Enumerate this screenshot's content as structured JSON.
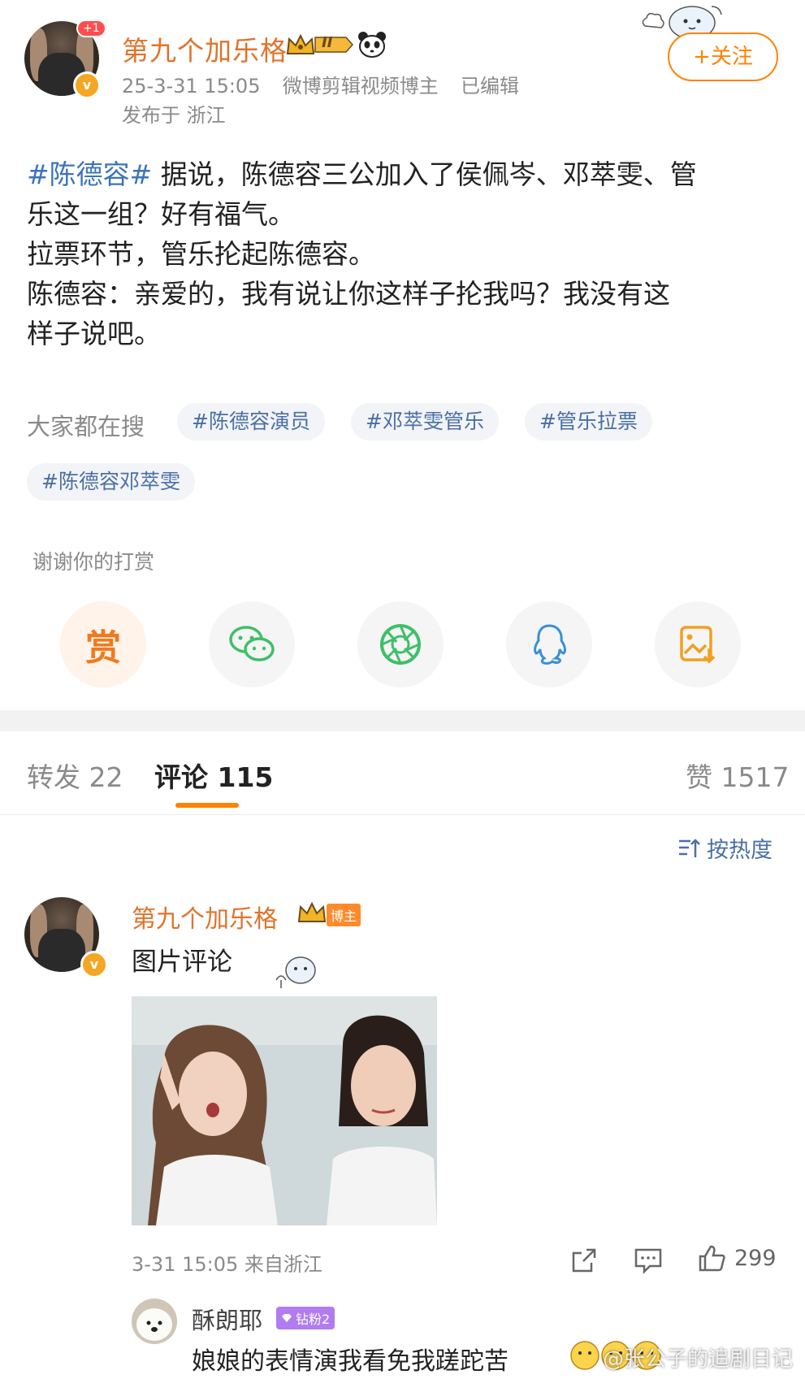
{
  "post": {
    "author": "第九个加乐格",
    "notification_count": "+1",
    "level_badge": "II",
    "date": "25-3-31 15:05",
    "author_title": "微博剪辑视频博主",
    "edited_label": "已编辑",
    "location": "发布于 浙江",
    "follow_label": "+关注",
    "hashtag": "#陈德容#",
    "text_line1_rest": " 据说，陈德容三公加入了侯佩岑、邓萃雯、管",
    "text_line2": "乐这一组？好有福气。",
    "text_line3": "拉票环节，管乐抡起陈德容。",
    "text_line4": "陈德容：亲爱的，我有说让你这样子抡我吗？我没有这",
    "text_line5": "样子说吧。"
  },
  "search": {
    "label": "大家都在搜",
    "tags": [
      "#陈德容演员",
      "#邓萃雯管乐",
      "#管乐拉票",
      "#陈德容邓萃雯"
    ]
  },
  "reward": {
    "thanks_label": "谢谢你的打赏",
    "reward_char": "赏",
    "actions": [
      "reward-icon",
      "wechat-icon",
      "moments-icon",
      "qq-icon",
      "save-image-icon"
    ]
  },
  "tabs": {
    "repost": "转发 22",
    "comment": "评论 115",
    "like": "赞 1517"
  },
  "sort_label": "按热度",
  "comment": {
    "author": "第九个加乐格",
    "blogger_tag": "博主",
    "text": "图片评论",
    "time": "3-31 15:05 来自浙江",
    "likes": "299"
  },
  "reply": {
    "author": "酥朗耶",
    "fan_tag": "钻粉2",
    "text": "娘娘的表情演我看免我蹉跎苦"
  },
  "watermark": "@张公子的追剧日记",
  "colors": {
    "accent": "#ff8200",
    "username": "#e0742b",
    "link": "#3d74b8"
  }
}
